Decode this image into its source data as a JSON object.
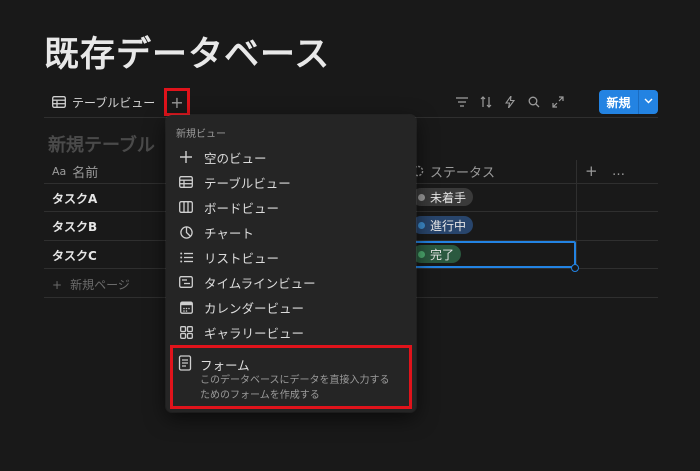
{
  "page": {
    "title": "既存データベース"
  },
  "toolbar": {
    "view_tab_label": "テーブルビュー",
    "add_view_label": "+",
    "icons": [
      "filter-icon",
      "sort-icon",
      "automation-icon",
      "search-icon",
      "expand-icon"
    ],
    "new_button_label": "新規",
    "new_button_color": "#2383e2"
  },
  "table": {
    "title": "新規テーブル",
    "columns": [
      {
        "icon": "Aa",
        "label": "名前"
      },
      {
        "icon": "status-icon",
        "label": "ステータス"
      }
    ],
    "add_column_label": "+",
    "more_label": "…",
    "rows": [
      {
        "name": "タスクA",
        "status": "未着手",
        "status_color": "#5a5a5a",
        "dot_color": "#9b9b9b",
        "pill_bg": "#3a3a3a"
      },
      {
        "name": "タスクB",
        "status": "進行中",
        "status_color": "#28456c",
        "dot_color": "#3e8ed0",
        "pill_bg": "#28456c"
      },
      {
        "name": "タスクC",
        "status": "完了",
        "status_color": "#2b593f",
        "dot_color": "#4dab6f",
        "pill_bg": "#2b593f"
      }
    ],
    "new_page_label": "新規ページ"
  },
  "menu": {
    "section_label": "新規ビュー",
    "items": [
      {
        "icon": "plus-icon",
        "label": "空のビュー"
      },
      {
        "icon": "table-icon",
        "label": "テーブルビュー"
      },
      {
        "icon": "board-icon",
        "label": "ボードビュー"
      },
      {
        "icon": "chart-icon",
        "label": "チャート"
      },
      {
        "icon": "list-icon",
        "label": "リストビュー"
      },
      {
        "icon": "timeline-icon",
        "label": "タイムラインビュー"
      },
      {
        "icon": "calendar-icon",
        "label": "カレンダービュー"
      },
      {
        "icon": "gallery-icon",
        "label": "ギャラリービュー"
      }
    ],
    "form": {
      "icon": "form-icon",
      "label": "フォーム",
      "description_line1": "このデータベースにデータを直接入力する",
      "description_line2": "ためのフォームを作成する"
    }
  },
  "highlight_color": "#e0131b"
}
